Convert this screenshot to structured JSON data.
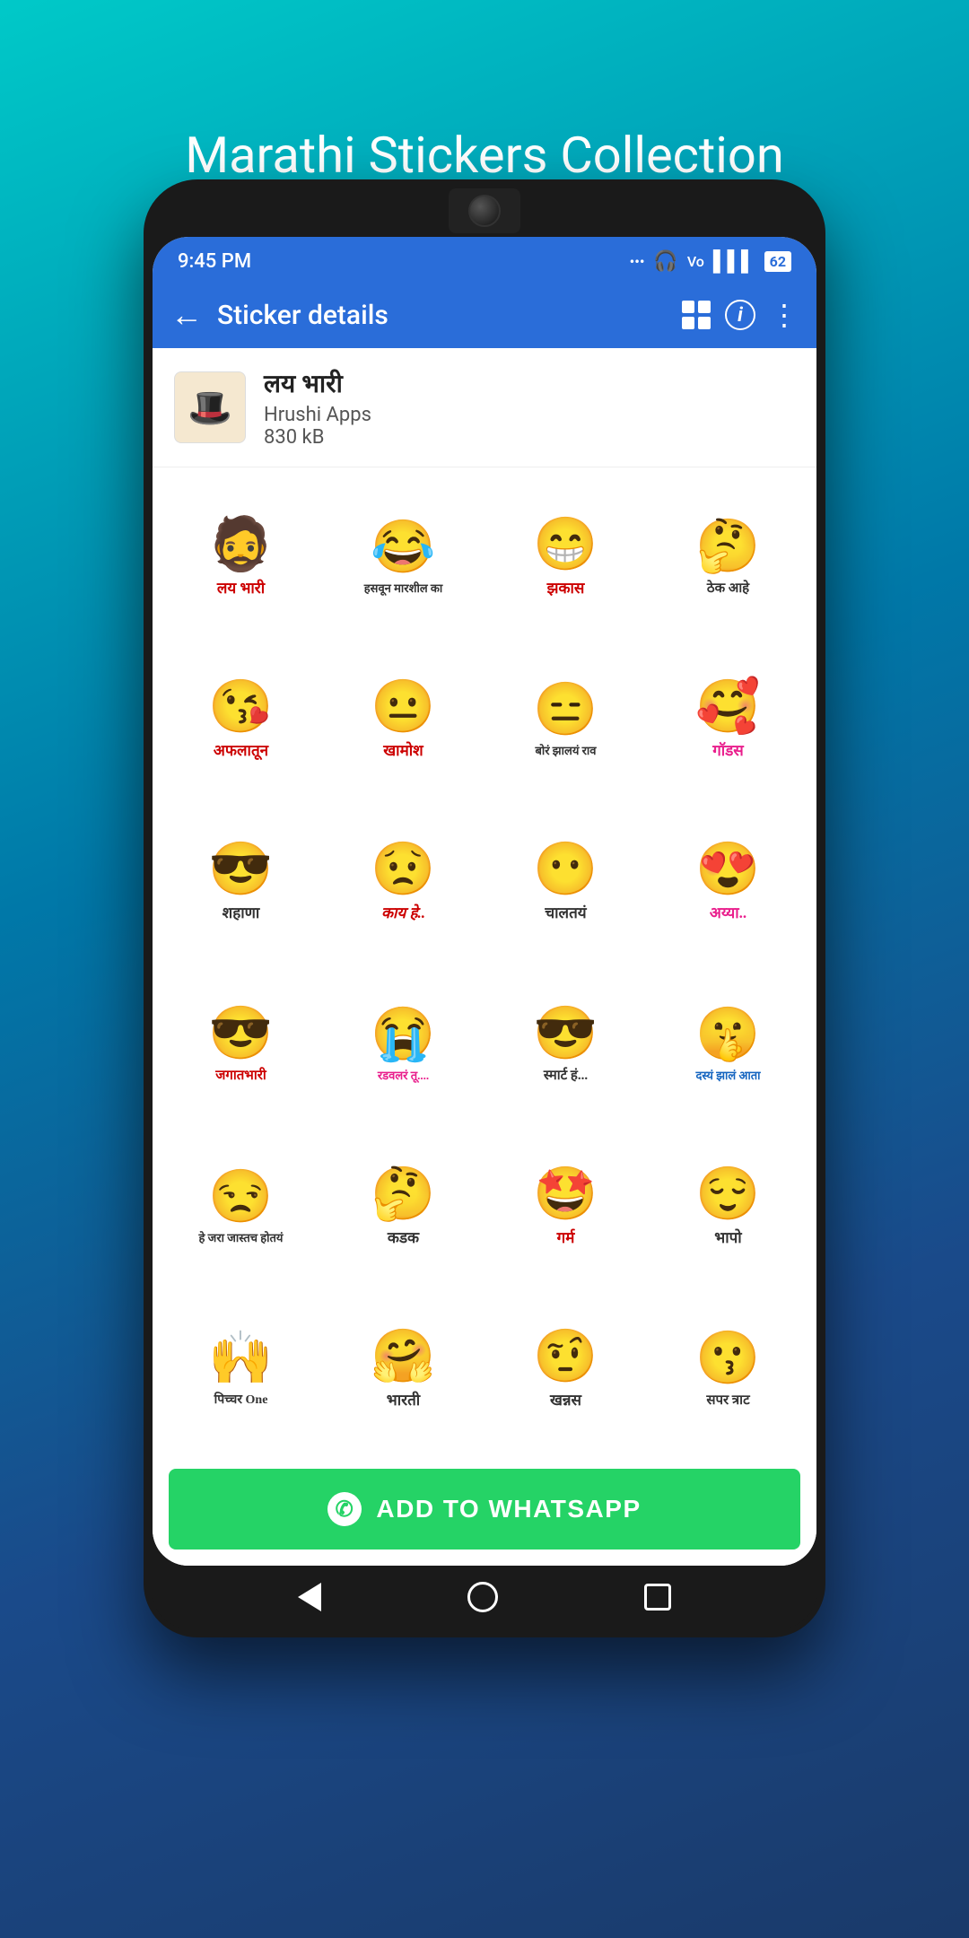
{
  "page": {
    "title": "Marathi Stickers Collection",
    "background": "linear-gradient(160deg, #00c9c8 0%, #0078a8 40%, #1a4a8a 70%, #1a3a6a 100%)"
  },
  "status_bar": {
    "time": "9:45 PM",
    "battery": "62"
  },
  "app_bar": {
    "title": "Sticker details",
    "back_label": "←"
  },
  "sticker_pack": {
    "name": "लय भारी",
    "author": "Hrushi Apps",
    "size": "830 kB"
  },
  "stickers": [
    {
      "emoji": "😎🎩",
      "label": "लय भारी",
      "label_color": "red"
    },
    {
      "emoji": "😂🔫",
      "label": "हसवून मारशील का",
      "label_color": "dark"
    },
    {
      "emoji": "😁",
      "label": "झकास",
      "label_color": "red"
    },
    {
      "emoji": "🤔",
      "label": "ठेक आहे",
      "label_color": "dark"
    },
    {
      "emoji": "😘",
      "label": "अफलातून",
      "label_color": "red"
    },
    {
      "emoji": "😐✋",
      "label": "खामोश",
      "label_color": "red"
    },
    {
      "emoji": "😐🎈",
      "label": "बोरं झालयं राव",
      "label_color": "dark"
    },
    {
      "emoji": "😊❤️",
      "label": "गॉडस",
      "label_color": "pink"
    },
    {
      "emoji": "😎",
      "label": "शहाणा",
      "label_color": "dark"
    },
    {
      "emoji": "😟💧",
      "label": "काय हे..",
      "label_color": "red"
    },
    {
      "emoji": "👍😐",
      "label": "चालतयं",
      "label_color": "dark"
    },
    {
      "emoji": "😍",
      "label": "अय्या..",
      "label_color": "pink"
    },
    {
      "emoji": "😎👍",
      "label": "जगात भारी",
      "label_color": "red"
    },
    {
      "emoji": "😭",
      "label": "रडवलरं तू....",
      "label_color": "pink"
    },
    {
      "emoji": "😎",
      "label": "स्मार्ट हं...",
      "label_color": "dark"
    },
    {
      "emoji": "🤫",
      "label": "दस्यं झालं आता",
      "label_color": "blue"
    },
    {
      "emoji": "😌",
      "label": "हे जरा जास्तच होतयं",
      "label_color": "dark"
    },
    {
      "emoji": "🤔",
      "label": "कडक",
      "label_color": "dark"
    },
    {
      "emoji": "😆",
      "label": "गर्म",
      "label_color": "red"
    },
    {
      "emoji": "😊",
      "label": "भापो",
      "label_color": "dark"
    },
    {
      "emoji": "🙌😂",
      "label": "पिच्चर One",
      "label_color": "dark"
    },
    {
      "emoji": "🤔😄",
      "label": "भारती",
      "label_color": "dark"
    },
    {
      "emoji": "🤨",
      "label": "खन्नस",
      "label_color": "dark"
    },
    {
      "emoji": "😗❤️",
      "label": "सपर त्राट",
      "label_color": "dark"
    }
  ],
  "add_button": {
    "label": "ADD TO WHATSAPP"
  }
}
